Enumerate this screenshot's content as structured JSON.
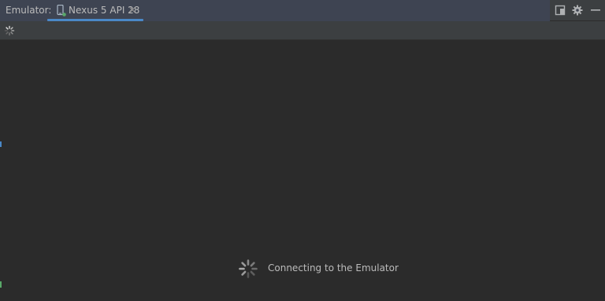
{
  "panel": {
    "title": "Emulator:"
  },
  "tabs": [
    {
      "label": "Nexus 5 API 28",
      "icon": "device-phone-icon",
      "active": true,
      "close_glyph": "✕"
    }
  ],
  "top_right_icons": [
    {
      "name": "layout-icon"
    },
    {
      "name": "gear-icon"
    },
    {
      "name": "minimize-icon"
    }
  ],
  "toolbar": {
    "spinner_icon": "loading-spinner-icon"
  },
  "status": {
    "message": "Connecting to the Emulator",
    "icon": "loading-spinner-icon"
  },
  "colors": {
    "accent": "#4a88c7",
    "device_status": "#59a869",
    "background": "#2b2b2b",
    "header": "#3c3f41"
  }
}
